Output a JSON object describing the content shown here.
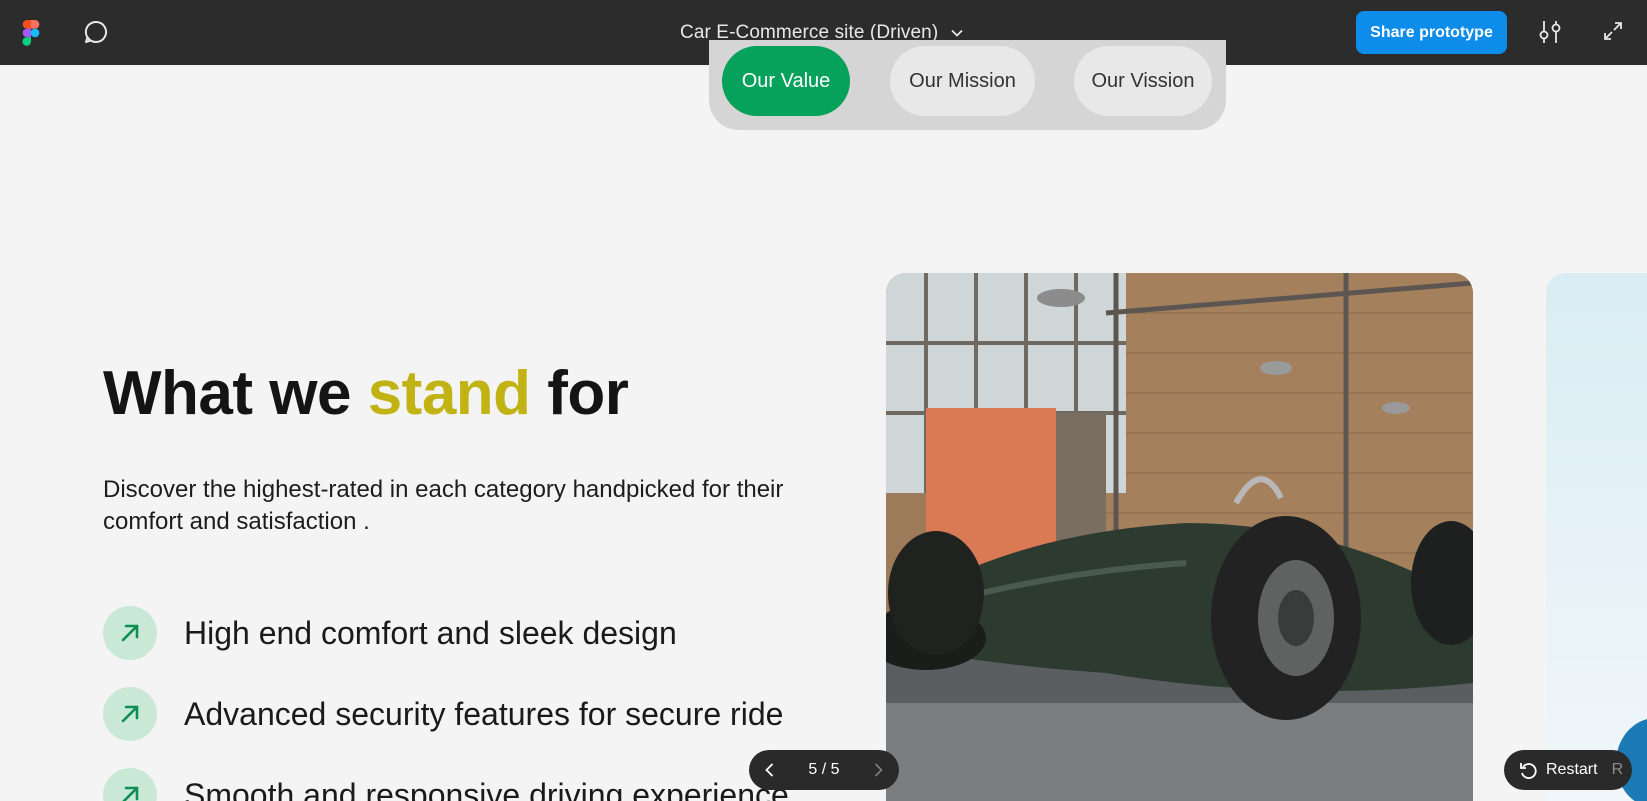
{
  "toolbar": {
    "title": "Car E-Commerce site (Driven)",
    "share_label": "Share prototype"
  },
  "tabs": [
    {
      "label": "Our Value",
      "active": true
    },
    {
      "label": "Our Mission",
      "active": false
    },
    {
      "label": "Our Vission",
      "active": false
    }
  ],
  "hero": {
    "heading_prefix": "What we ",
    "heading_accent": "stand",
    "heading_suffix": " for",
    "description": "Discover the highest-rated in each category handpicked for their comfort and satisfaction ."
  },
  "features": [
    {
      "text": "High end comfort and sleek design"
    },
    {
      "text": "Advanced security features for secure ride"
    },
    {
      "text": "Smooth and  responsive driving experience"
    }
  ],
  "pager": {
    "current": "5 / 5"
  },
  "restart": {
    "label": "Restart",
    "shortcut": "R"
  },
  "colors": {
    "accent_green": "#06a15a",
    "accent_yellow": "#c2b314",
    "share_blue": "#0d8ce9",
    "toolbar_bg": "#2c2c2c"
  }
}
